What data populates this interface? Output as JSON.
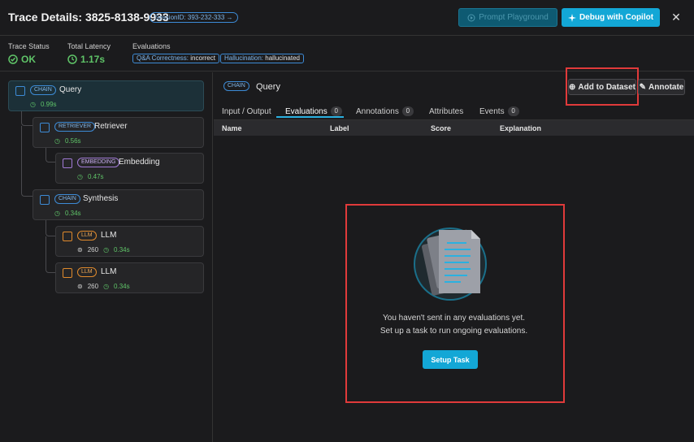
{
  "header": {
    "title": "Trace Details: 3825-8138-9933",
    "session_badge": "SessionID: 393-232-333 →",
    "playground_label": "Prompt Playground",
    "copilot_label": "Debug with Copilot",
    "close_glyph": "✕"
  },
  "status": {
    "trace_status_label": "Trace Status",
    "trace_status_value": "OK",
    "latency_label": "Total Latency",
    "latency_value": "1.17s",
    "evaluations_label": "Evaluations",
    "evaluations": [
      {
        "key": "Q&A Correctness:",
        "value": "incorrect"
      },
      {
        "key": "Hallucination:",
        "value": "hallucinated"
      }
    ]
  },
  "tree": {
    "nodes": [
      {
        "kind": "CHAIN",
        "name": "Query",
        "latency": "0.99s",
        "tokens": ""
      },
      {
        "kind": "RETRIEVER",
        "name": "Retriever",
        "latency": "0.56s",
        "tokens": ""
      },
      {
        "kind": "EMBEDDING",
        "name": "Embedding",
        "latency": "0.47s",
        "tokens": ""
      },
      {
        "kind": "CHAIN",
        "name": "Synthesis",
        "latency": "0.34s",
        "tokens": ""
      },
      {
        "kind": "LLM",
        "name": "LLM",
        "latency": "0.34s",
        "tokens": "260"
      },
      {
        "kind": "LLM",
        "name": "LLM",
        "latency": "0.34s",
        "tokens": "260"
      }
    ]
  },
  "panel": {
    "kind": "CHAIN",
    "title": "Query",
    "add_dataset_label": "Add to Dataset",
    "annotate_label": "Annotate",
    "tabs": [
      {
        "label": "Input / Output",
        "count": ""
      },
      {
        "label": "Evaluations",
        "count": "0"
      },
      {
        "label": "Annotations",
        "count": "0"
      },
      {
        "label": "Attributes",
        "count": ""
      },
      {
        "label": "Events",
        "count": "0"
      }
    ],
    "columns": [
      "Name",
      "Label",
      "Score",
      "Explanation"
    ],
    "empty_line1": "You haven't sent in any evaluations yet.",
    "empty_line2": "Set up a task to run ongoing evaluations.",
    "setup_label": "Setup Task"
  },
  "colors": {
    "accent": "#13a7d6",
    "ok_green": "#5fc468",
    "highlight_red": "#e03a3a"
  }
}
